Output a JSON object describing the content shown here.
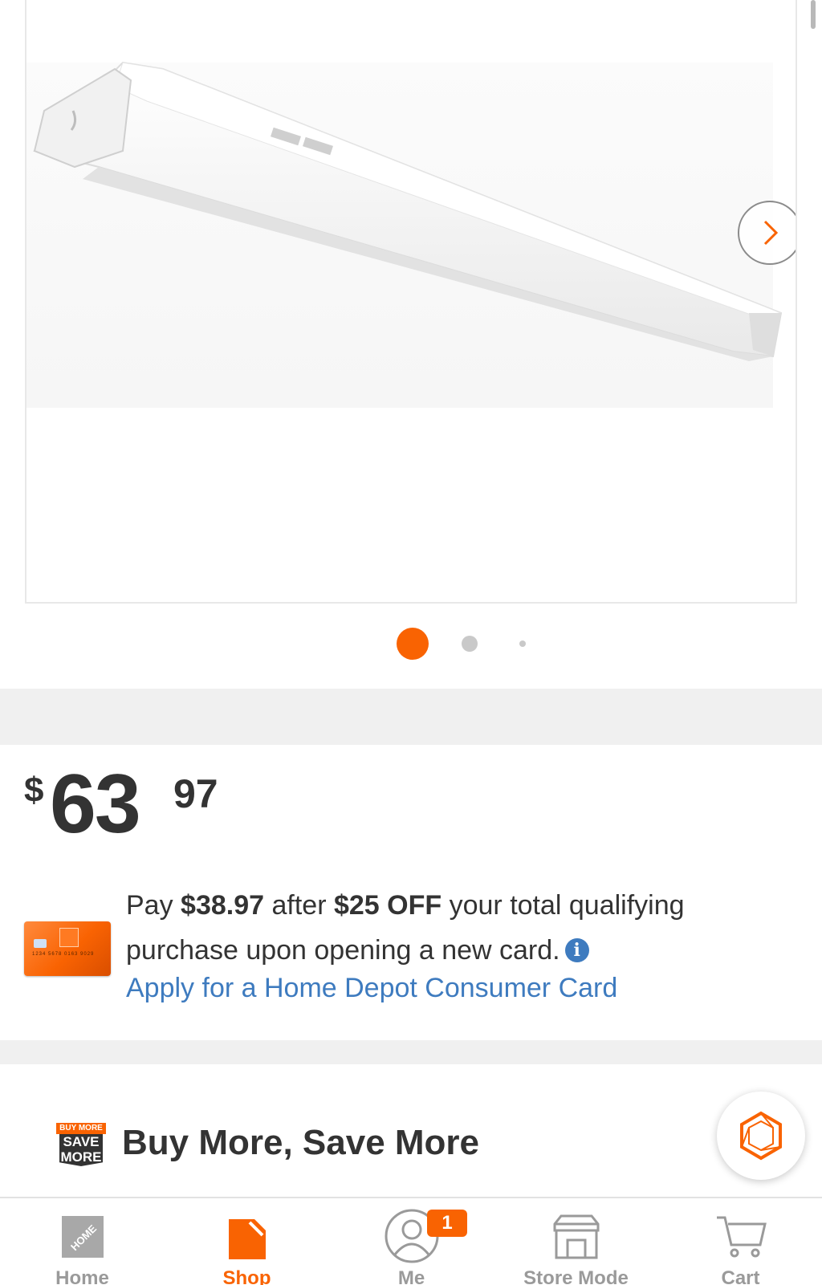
{
  "carousel": {
    "next_label": "Next image",
    "slide_count": 3,
    "active_index": 0
  },
  "price": {
    "currency": "$",
    "dollars": "63",
    "cents": "97"
  },
  "card_offer": {
    "text_1": "Pay ",
    "amount": "$38.97",
    "text_2": " after ",
    "discount": "$25 OFF",
    "text_3": " your total qualifying purchase upon opening a new card.",
    "apply_link": "Apply for a Home Depot Consumer Card"
  },
  "bmsm": {
    "badge_top": "BUY MORE",
    "badge_line1": "SAVE",
    "badge_line2": "MORE",
    "title": "Buy More, Save More"
  },
  "tabbar": {
    "tabs": [
      {
        "label": "Home",
        "icon": "home-depot-logo-icon"
      },
      {
        "label": "Shop",
        "icon": "shop-bag-icon",
        "active": true
      },
      {
        "label": "Me",
        "icon": "user-icon",
        "badge": "1"
      },
      {
        "label": "Store Mode",
        "icon": "store-icon"
      },
      {
        "label": "Cart",
        "icon": "cart-icon"
      }
    ]
  },
  "colors": {
    "brand_orange": "#f96302",
    "link_blue": "#3e7bbf",
    "text_dark": "#333333",
    "tab_inactive": "#9a9a9a"
  }
}
